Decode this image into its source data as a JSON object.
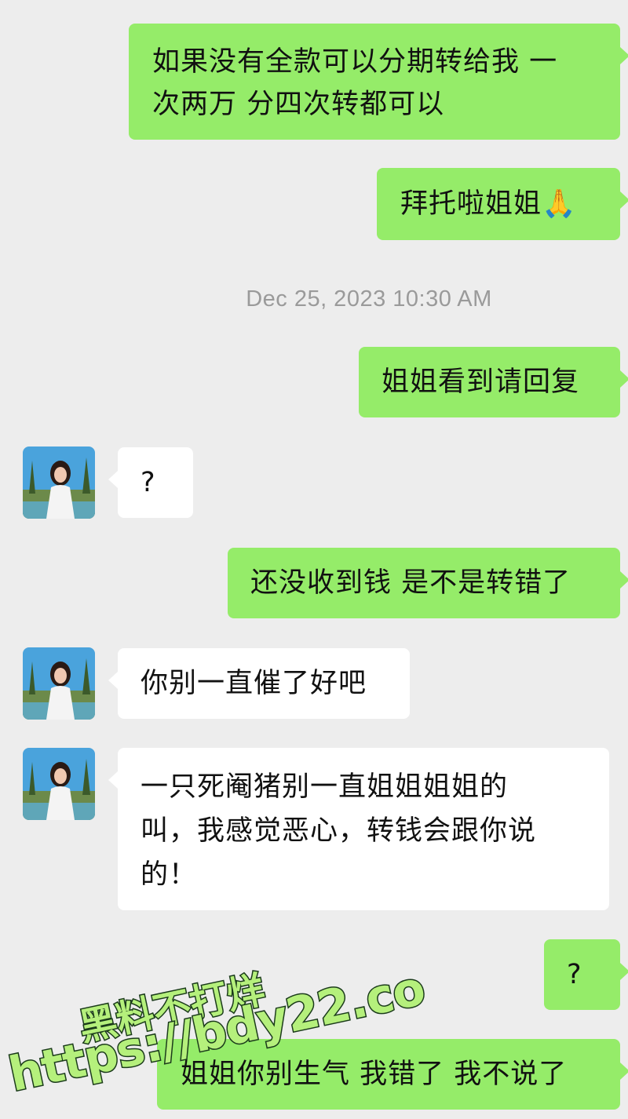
{
  "timestamp": "Dec 25, 2023 10:30 AM",
  "messages": [
    {
      "side": "right",
      "line1": "如果没有全款可以分期转给我 一",
      "line2": "次两万 分四次转都可以"
    },
    {
      "side": "right",
      "text": "拜托啦姐姐",
      "emoji": "🙏"
    },
    {
      "side": "right",
      "text": "姐姐看到请回复"
    },
    {
      "side": "left",
      "text": "?"
    },
    {
      "side": "right",
      "text": "还没收到钱 是不是转错了"
    },
    {
      "side": "left",
      "text": "你别一直催了好吧"
    },
    {
      "side": "left",
      "line1": "一只死阉猪别一直姐姐姐姐的",
      "line2": "叫，我感觉恶心，转钱会跟你说",
      "line3": "的！"
    },
    {
      "side": "right",
      "text": "?"
    },
    {
      "side": "right",
      "text": "姐姐你别生气 我错了 我不说了"
    }
  ],
  "watermark": {
    "line1": "黑料不打烊",
    "line2": "https://bdy22.co"
  },
  "colors": {
    "sent_bubble": "#95ec69",
    "received_bubble": "#ffffff",
    "background": "#ededed"
  }
}
